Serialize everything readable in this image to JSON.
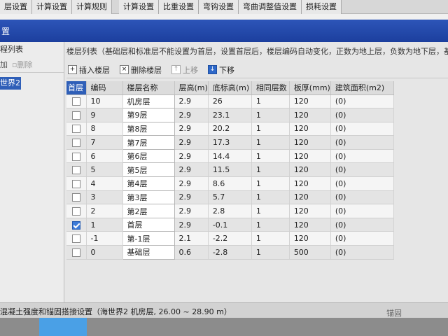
{
  "topbar": {
    "tabs": [
      "层设置",
      "计算设置",
      "计算规则",
      "计算设置",
      "比重设置",
      "弯钩设置",
      "弯曲调整值设置",
      "损耗设置"
    ]
  },
  "titlebar": {
    "title": "置"
  },
  "left": {
    "header": "程列表",
    "add_label": "加",
    "delete_label": "删除",
    "selected_item": "世界2"
  },
  "main": {
    "hint": "楼层列表（基础层和标准层不能设置为首层，设置首层后，楼层编码自动变化，正数为地上层，负数为地下层，基础",
    "toolbar": {
      "insert": "插入楼层",
      "delete": "删除楼层",
      "up": "上移",
      "down": "下移"
    },
    "table": {
      "headers": [
        "首层",
        "编码",
        "楼层名称",
        "层高(m)",
        "底标高(m)",
        "相同层数",
        "板厚(mm)",
        "建筑面积(m2)"
      ],
      "rows": [
        {
          "checked": false,
          "code": "10",
          "name": "机房层",
          "height": "2.9",
          "base": "26",
          "same": "1",
          "slab": "120",
          "area": "(0)"
        },
        {
          "checked": false,
          "code": "9",
          "name": "第9层",
          "height": "2.9",
          "base": "23.1",
          "same": "1",
          "slab": "120",
          "area": "(0)"
        },
        {
          "checked": false,
          "code": "8",
          "name": "第8层",
          "height": "2.9",
          "base": "20.2",
          "same": "1",
          "slab": "120",
          "area": "(0)"
        },
        {
          "checked": false,
          "code": "7",
          "name": "第7层",
          "height": "2.9",
          "base": "17.3",
          "same": "1",
          "slab": "120",
          "area": "(0)"
        },
        {
          "checked": false,
          "code": "6",
          "name": "第6层",
          "height": "2.9",
          "base": "14.4",
          "same": "1",
          "slab": "120",
          "area": "(0)"
        },
        {
          "checked": false,
          "code": "5",
          "name": "第5层",
          "height": "2.9",
          "base": "11.5",
          "same": "1",
          "slab": "120",
          "area": "(0)"
        },
        {
          "checked": false,
          "code": "4",
          "name": "第4层",
          "height": "2.9",
          "base": "8.6",
          "same": "1",
          "slab": "120",
          "area": "(0)"
        },
        {
          "checked": false,
          "code": "3",
          "name": "第3层",
          "height": "2.9",
          "base": "5.7",
          "same": "1",
          "slab": "120",
          "area": "(0)"
        },
        {
          "checked": false,
          "code": "2",
          "name": "第2层",
          "height": "2.9",
          "base": "2.8",
          "same": "1",
          "slab": "120",
          "area": "(0)"
        },
        {
          "checked": true,
          "code": "1",
          "name": "首层",
          "height": "2.9",
          "base": "-0.1",
          "same": "1",
          "slab": "120",
          "area": "(0)"
        },
        {
          "checked": false,
          "code": "-1",
          "name": "第-1层",
          "height": "2.1",
          "base": "-2.2",
          "same": "1",
          "slab": "120",
          "area": "(0)"
        },
        {
          "checked": false,
          "code": "0",
          "name": "基础层",
          "height": "0.6",
          "base": "-2.8",
          "same": "1",
          "slab": "500",
          "area": "(0)"
        }
      ]
    }
  },
  "status": {
    "text": "混凝土强度和锚固搭接设置（海世界2  机房层, 26.00 ~ 28.90 m）",
    "right": "锚固"
  },
  "colors": {
    "title_blue": "#1f44a4",
    "selected_blue": "#2f5fb8",
    "check_blue": "#3d7bd8"
  }
}
